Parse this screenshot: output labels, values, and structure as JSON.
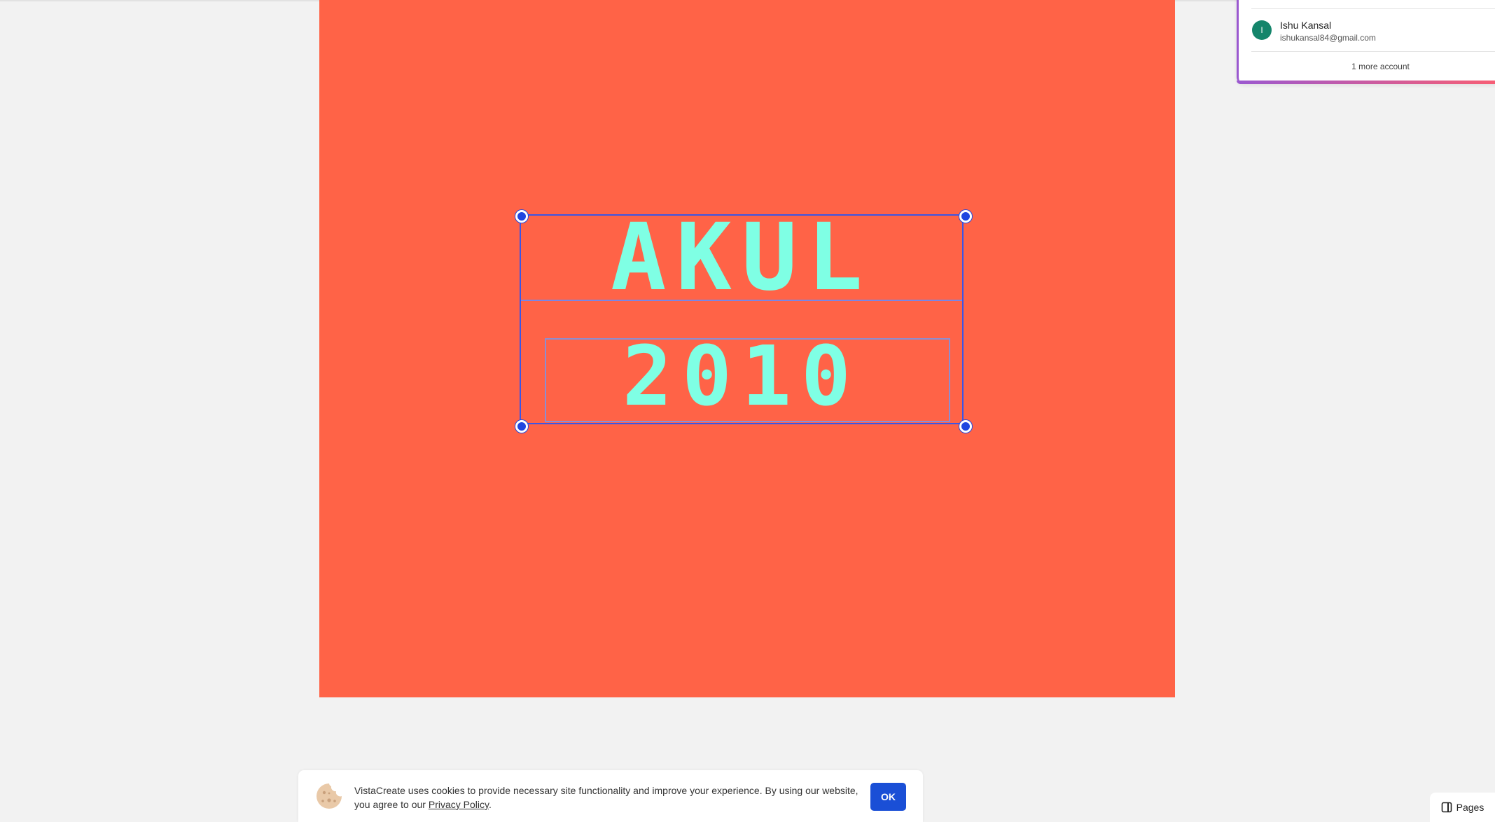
{
  "canvas": {
    "background_color": "#ff6347",
    "text_color": "#7fffe4",
    "line1": "AKUL",
    "line2": "2010"
  },
  "account": {
    "avatar_initial": "I",
    "name": "Ishu Kansal",
    "email": "ishukansal84@gmail.com",
    "more_accounts": "1 more account"
  },
  "cookie_banner": {
    "text": "VistaCreate uses cookies to provide necessary site functionality and improve your experience. By using our website, you agree to our ",
    "link": "Privacy Policy",
    "suffix": ".",
    "ok_label": "OK",
    "icon": "cookie-icon"
  },
  "pages_button": {
    "label": "Pages",
    "icon": "panel-icon"
  },
  "colors": {
    "selection": "#3b55e6",
    "accent_button": "#1a4fd6",
    "avatar": "#14856b"
  }
}
